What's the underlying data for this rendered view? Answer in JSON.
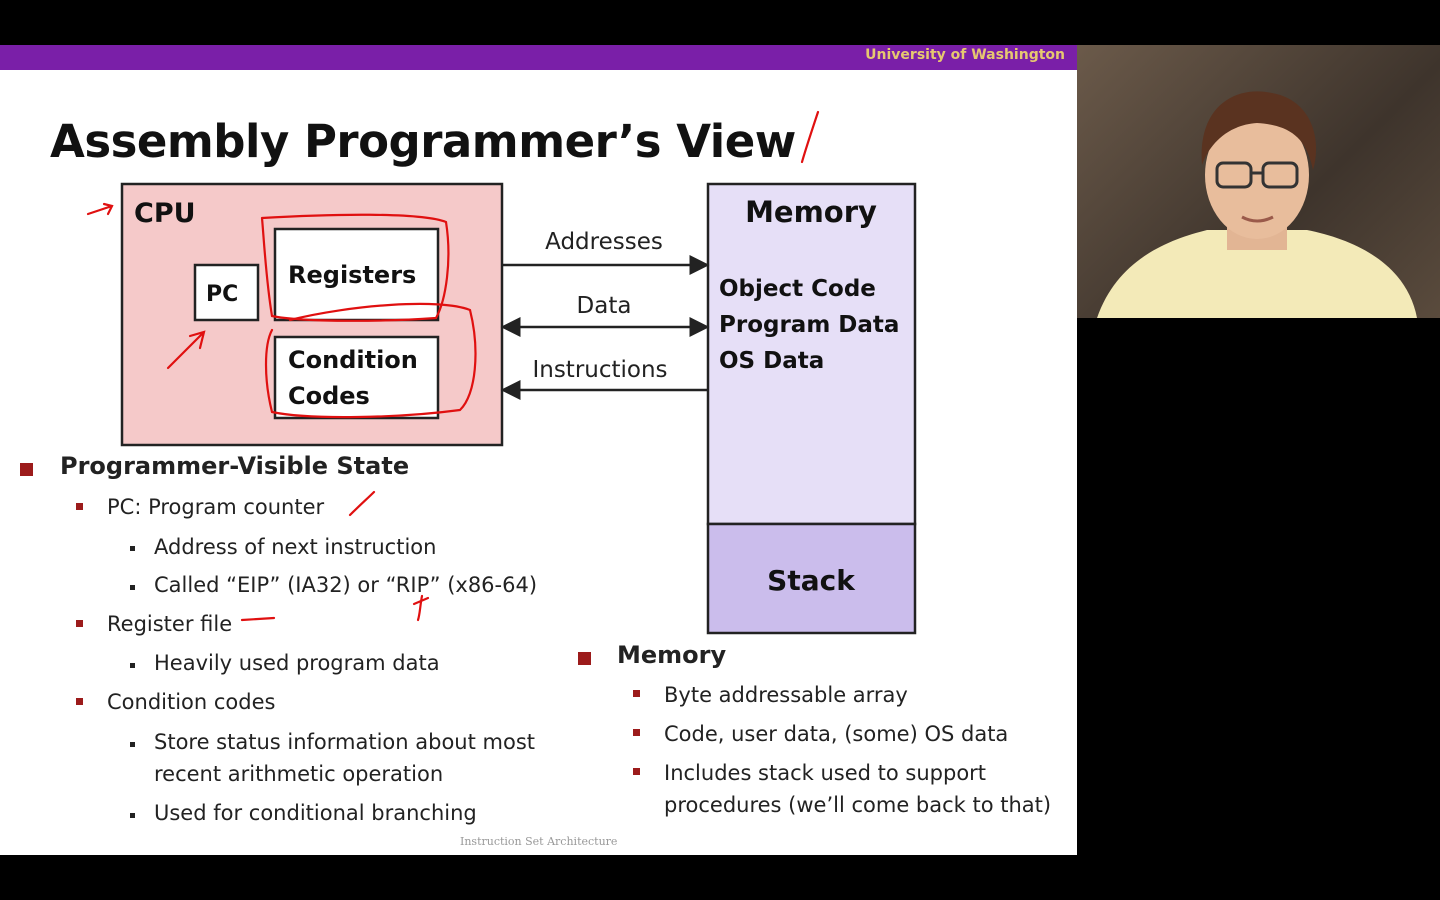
{
  "slide": {
    "header_brand": "University of Washington",
    "title": "Assembly Programmer’s View",
    "footer": "Instruction Set Architecture",
    "diagram": {
      "cpu_label": "CPU",
      "pc_label": "PC",
      "registers_label": "Registers",
      "condition_codes_line1": "Condition",
      "condition_codes_line2": "Codes",
      "memory_label": "Memory",
      "memory_items": [
        "Object Code",
        "Program Data",
        "OS Data"
      ],
      "stack_label": "Stack",
      "arrows": {
        "addresses": "Addresses",
        "data": "Data",
        "instructions": "Instructions"
      }
    },
    "left_bullets": {
      "heading": "Programmer-Visible State",
      "items": [
        {
          "label": "PC: Program counter",
          "sub": [
            "Address of next instruction",
            "Called “EIP” (IA32) or “RIP” (x86-64)"
          ]
        },
        {
          "label": "Register file",
          "sub": [
            "Heavily used program data"
          ]
        },
        {
          "label": "Condition codes",
          "sub": [
            "Store status information about most",
            "recent arithmetic operation",
            "Used for conditional branching"
          ]
        }
      ]
    },
    "right_bullets": {
      "heading": "Memory",
      "items": [
        "Byte addressable array",
        "Code, user data, (some) OS data",
        "Includes stack used to support",
        "procedures (we’ll come back to that)"
      ]
    }
  },
  "colors": {
    "header": "#7a1fa8",
    "brand_text": "#e6c870",
    "cpu_fill": "#f5c9c9",
    "memory_fill": "#e6dff7",
    "stack_fill": "#cbbdec",
    "ink": "#e01010"
  }
}
